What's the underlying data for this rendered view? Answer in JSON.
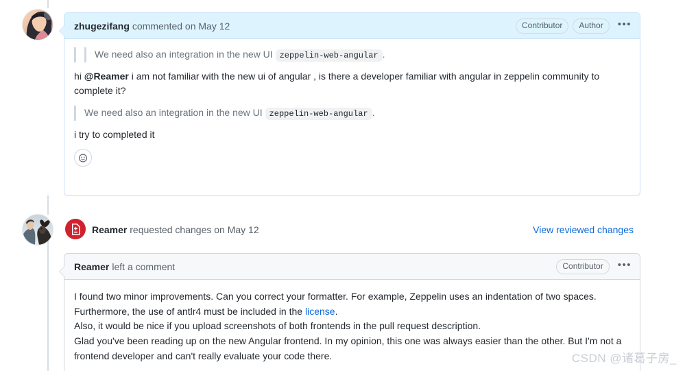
{
  "comments": [
    {
      "author": "zhugezifang",
      "meta": "commented on May 12",
      "badges": [
        "Contributor",
        "Author"
      ],
      "menu": "•••",
      "quote1_prefix": "We need also an integration in the new UI",
      "quote1_code": "zeppelin-web-angular",
      "quote1_suffix": ".",
      "reply_prefix": "hi ",
      "reply_mention": "@Reamer",
      "reply_text": " i am not familiar with the new ui of angular , is there a developer familiar with angular in zeppelin community to complete it?",
      "quote2_prefix": "We need also an integration in the new UI",
      "quote2_code": "zeppelin-web-angular",
      "quote2_suffix": ".",
      "closing": "i try to completed it",
      "reaction_icon": "smiley-icon"
    }
  ],
  "review_event": {
    "icon": "diff-file-icon",
    "author": "Reamer",
    "meta": " requested changes on May 12",
    "link_label": "View reviewed changes"
  },
  "review_comment": {
    "author": "Reamer",
    "meta": "left a comment",
    "badges": [
      "Contributor"
    ],
    "menu": "•••",
    "line1": "I found two minor improvements. Can you correct your formatter. For example, Zeppelin uses an indentation of two spaces.",
    "line2_prefix": "Furthermore, the use of antlr4 must be included in the ",
    "line2_link": "license",
    "line2_suffix": ".",
    "line3": "Also, it would be nice if you upload screenshots of both frontends in the pull request description.",
    "line4": "Glad you've been reading up on the new Angular frontend. In my opinion, this one was always easier than the other. But I'm not a frontend developer and can't really evaluate your code there."
  },
  "watermark": "CSDN @诸葛子房_",
  "colors": {
    "header_blue_bg": "#ddf4ff",
    "header_blue_border": "#c8e1f9",
    "link_blue": "#0969da",
    "review_red": "#cf222e",
    "text": "#24292f",
    "muted": "#57606a"
  }
}
